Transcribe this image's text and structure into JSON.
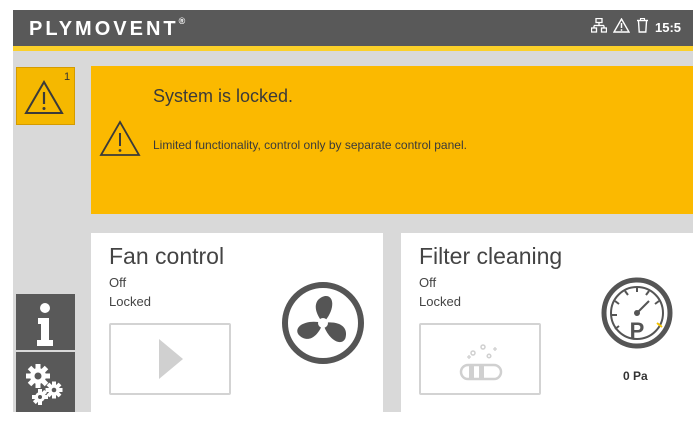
{
  "header": {
    "logo_text": "PLYMOVENT",
    "logo_mark": "®",
    "time": "15:5",
    "status_icons": [
      "network-icon",
      "warning-icon",
      "trash-icon"
    ]
  },
  "sidebar": {
    "alarm_count": "1",
    "alarm_icon": "warning-icon",
    "info_icon": "info-icon",
    "settings_icon": "gears-icon"
  },
  "banner": {
    "title": "System is locked.",
    "message": "Limited functionality, control only by separate control panel."
  },
  "cards": [
    {
      "title": "Fan control",
      "state": "Off",
      "lock": "Locked",
      "button_icon": "play-icon",
      "status_icon": "fan-icon"
    },
    {
      "title": "Filter cleaning",
      "state": "Off",
      "lock": "Locked",
      "button_icon": "filter-cleaning-icon",
      "status_icon": "pressure-gauge-icon",
      "pressure": "0 Pa",
      "pressure_symbol": "P"
    }
  ],
  "colors": {
    "topbar": "#595959",
    "accent": "#fbd02a",
    "banner": "#fbb900",
    "panel": "#d9d9d9"
  }
}
